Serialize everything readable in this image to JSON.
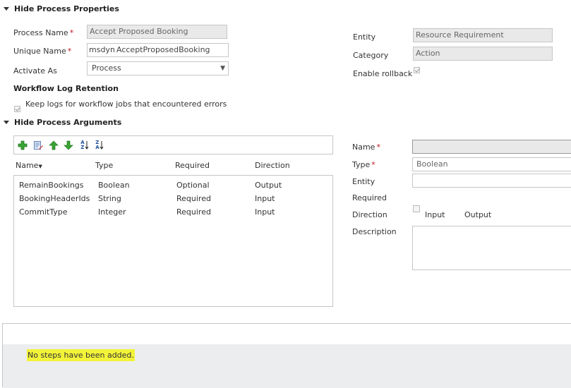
{
  "process_properties": {
    "header": "Hide Process Properties",
    "process_name_label": "Process Name",
    "process_name_value": "Accept Proposed Booking",
    "unique_name_label": "Unique Name",
    "unique_name_prefix": "msdyn_",
    "unique_name_value": "AcceptProposedBooking",
    "activate_as_label": "Activate As",
    "activate_as_value": "Process",
    "entity_label": "Entity",
    "entity_value": "Resource Requirement",
    "category_label": "Category",
    "category_value": "Action",
    "enable_rollback_label": "Enable rollback",
    "enable_rollback_checked": true
  },
  "log_retention": {
    "header": "Workflow Log Retention",
    "keep_logs_label": "Keep logs for workflow jobs that encountered errors",
    "keep_logs_checked": true
  },
  "process_arguments": {
    "header": "Hide Process Arguments",
    "columns": [
      "Name",
      "Type",
      "Required",
      "Direction"
    ],
    "rows": [
      {
        "name": "RemainBookings",
        "type": "Boolean",
        "required": "Optional",
        "direction": "Output"
      },
      {
        "name": "BookingHeaderIds",
        "type": "String",
        "required": "Required",
        "direction": "Input"
      },
      {
        "name": "CommitType",
        "type": "Integer",
        "required": "Required",
        "direction": "Input"
      }
    ],
    "toolbar_icons": [
      "add-icon",
      "edit-icon",
      "move-up-icon",
      "move-down-icon",
      "sort-ascending-icon",
      "sort-descending-icon"
    ],
    "sort_a": "A",
    "sort_z": "Z"
  },
  "argument_detail": {
    "name_label": "Name",
    "name_value": "",
    "type_label": "Type",
    "type_value": "Boolean",
    "entity_label": "Entity",
    "entity_value": "",
    "required_label": "Required",
    "direction_label": "Direction",
    "direction_input": "Input",
    "direction_output": "Output",
    "direction_selected": "Input",
    "description_label": "Description",
    "description_value": ""
  },
  "steps": {
    "empty_message": "No steps have been added."
  },
  "colors": {
    "required_star": "#c1121f",
    "highlight": "#f3f33a",
    "readonly_field": "#e9e9e9",
    "steps_background": "#ecedee"
  }
}
